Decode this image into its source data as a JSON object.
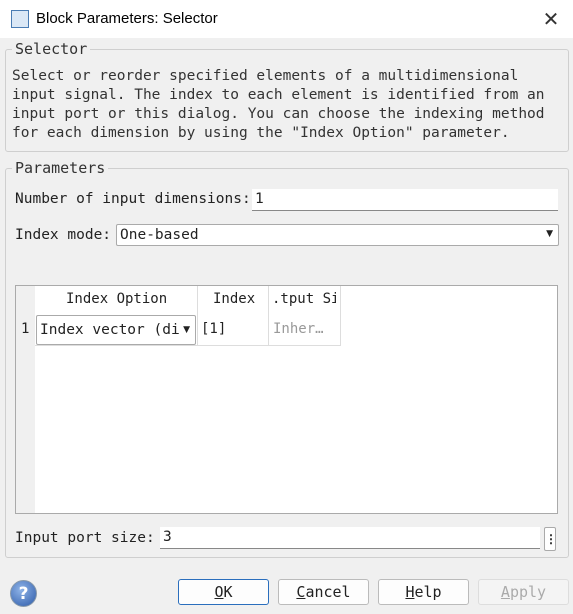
{
  "window": {
    "title": "Block Parameters: Selector"
  },
  "block": {
    "name": "Selector",
    "description": "Select or reorder specified elements of a multidimensional input signal. The index to each element is identified from an input port or this dialog. You can choose the indexing method for each dimension by using the \"Index Option\" parameter."
  },
  "parameters": {
    "group_label": "Parameters",
    "num_dims_label": "Number of input dimensions:",
    "num_dims_value": "1",
    "index_mode_label": "Index mode:",
    "index_mode_value": "One-based",
    "port_size_label": "Input port size:",
    "port_size_value": "3"
  },
  "table": {
    "headers": [
      "Index Option",
      "Index",
      ".tput Si"
    ],
    "rows": [
      {
        "num": "1",
        "option": "Index vector (di",
        "index": "[1]",
        "output": "Inher…"
      }
    ]
  },
  "buttons": {
    "ok_u": "O",
    "ok_rest": "K",
    "cancel_u": "C",
    "cancel_rest": "ancel",
    "help_u": "H",
    "help_rest": "elp",
    "apply_u": "A",
    "apply_rest": "pply"
  }
}
